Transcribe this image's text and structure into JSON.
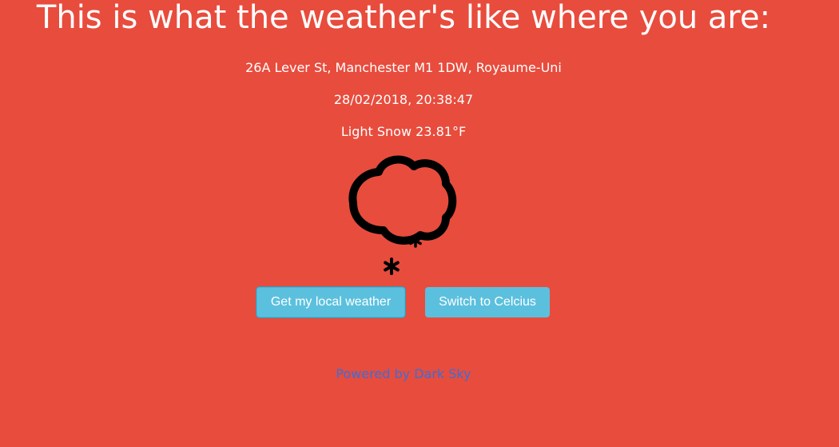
{
  "header": {
    "title": "This is what the weather's like where you are:"
  },
  "weather": {
    "address": "26A Lever St, Manchester M1 1DW, Royaume-Uni",
    "datetime": "28/02/2018, 20:38:47",
    "conditions": "Light Snow 23.81°F",
    "icon": "snow-cloud-icon"
  },
  "buttons": {
    "local_weather_label": "Get my local weather",
    "switch_units_label": "Switch to Celcius"
  },
  "footer": {
    "powered_by": "Powered by Dark Sky"
  },
  "colors": {
    "background": "#e84c3d",
    "button": "#5bc0de",
    "link": "#3a6fd8",
    "text": "#ffffff"
  }
}
